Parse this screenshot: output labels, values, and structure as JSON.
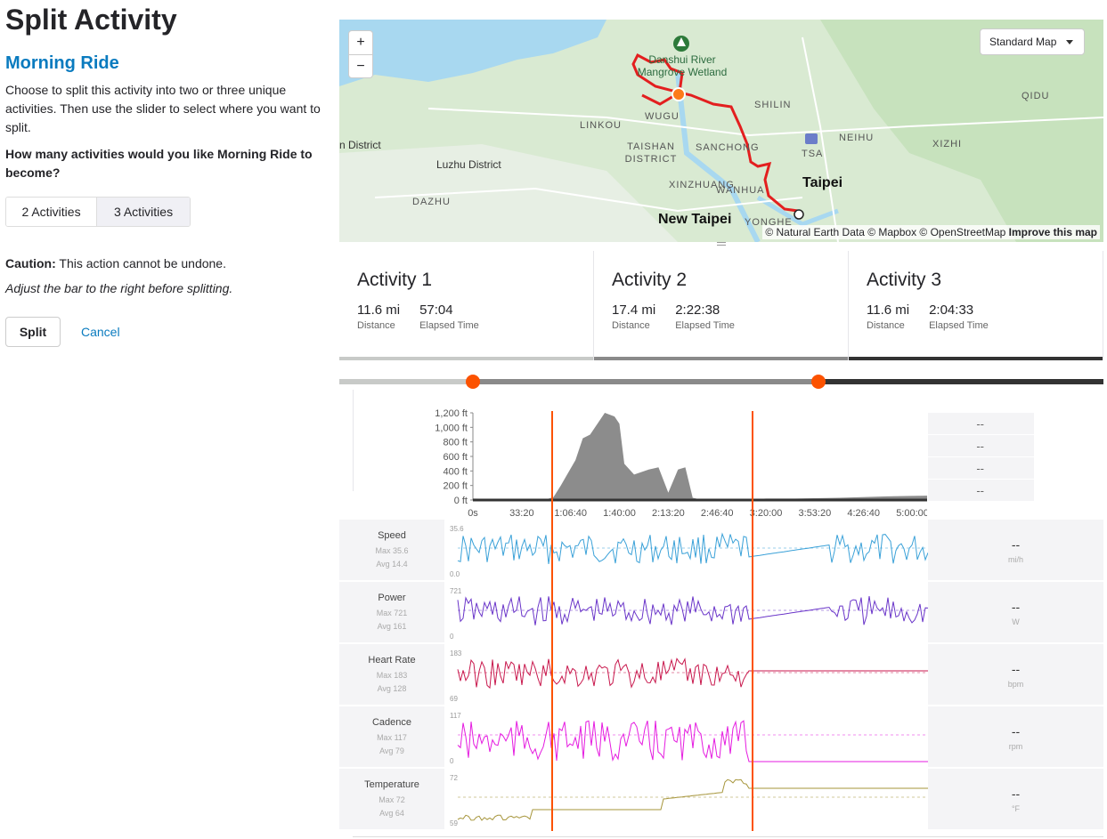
{
  "page_title": "Split Activity",
  "activity_name": "Morning Ride",
  "intro_text": "Choose to split this activity into two or three unique activities. Then use the slider to select where you want to split.",
  "question": "How many activities would you like Morning Ride to become?",
  "split_options": [
    "2 Activities",
    "3 Activities"
  ],
  "caution_label": "Caution:",
  "caution_text": " This action cannot be undone.",
  "hint_text": "Adjust the bar to the right before splitting.",
  "buttons": {
    "split": "Split",
    "cancel": "Cancel"
  },
  "map": {
    "zoom_in": "+",
    "zoom_out": "−",
    "style_select": "Standard Map",
    "attribution": "© Natural Earth Data © Mapbox © OpenStreetMap",
    "attribution_link": "Improve this map",
    "labels": {
      "wetland": "Danshui River Mangrove Wetland",
      "shilin": "SHILIN",
      "linkou": "LINKOU",
      "wugu": "WUGU",
      "neihu": "NEIHU",
      "qidu": "QIDU",
      "xizhi": "XIZHI",
      "taishan": "TAISHAN DISTRICT",
      "sanchong": "SANCHONG",
      "tsa": "TSA",
      "district_left": "n District",
      "luzhu": "Luzhu District",
      "taipei": "Taipei",
      "xinzhuang": "XINZHUANG",
      "wanhua": "WANHUA",
      "dazhu": "DAZHU",
      "new_taipei": "New Taipei",
      "yonghe": "YONGHE"
    }
  },
  "activities": [
    {
      "title": "Activity 1",
      "distance": "11.6 mi",
      "elapsed": "57:04",
      "distance_label": "Distance",
      "elapsed_label": "Elapsed Time",
      "color": "#c8cac8"
    },
    {
      "title": "Activity 2",
      "distance": "17.4 mi",
      "elapsed": "2:22:38",
      "distance_label": "Distance",
      "elapsed_label": "Elapsed Time",
      "color": "#8a8a8a"
    },
    {
      "title": "Activity 3",
      "distance": "11.6 mi",
      "elapsed": "2:04:33",
      "distance_label": "Distance",
      "elapsed_label": "Elapsed Time",
      "color": "#333333"
    }
  ],
  "split_points_fraction": [
    0.175,
    0.627
  ],
  "elevation_side_values": [
    "--",
    "--",
    "--",
    "--"
  ],
  "chart_data": {
    "type": "area",
    "title": "",
    "xlabel": "",
    "ylabel": "",
    "y_ticks": [
      "1,200 ft",
      "1,000 ft",
      "800 ft",
      "600 ft",
      "400 ft",
      "200 ft",
      "0 ft"
    ],
    "x_ticks": [
      "0s",
      "33:20",
      "1:06:40",
      "1:40:00",
      "2:13:20",
      "2:46:40",
      "3:20:00",
      "3:53:20",
      "4:26:40",
      "5:00:00"
    ],
    "ylim": [
      0,
      1200
    ],
    "x_seconds": [
      0,
      1800,
      3000,
      3300,
      3600,
      4200,
      4500,
      4800,
      5400,
      5800,
      6000,
      6200,
      6600,
      7200,
      7600,
      8000,
      8400,
      8700,
      9000,
      9300,
      9600,
      10200,
      10800,
      11400,
      12000,
      13200,
      15000,
      17000,
      18600
    ],
    "elevation_ft": [
      20,
      10,
      10,
      40,
      200,
      550,
      850,
      900,
      1200,
      1150,
      1050,
      500,
      350,
      420,
      450,
      100,
      420,
      450,
      30,
      10,
      10,
      10,
      10,
      10,
      20,
      20,
      30,
      50,
      60
    ],
    "series_color": "#8c8c8c"
  },
  "streams": [
    {
      "name": "Speed",
      "max": "Max 35.6",
      "avg": "Avg 14.4",
      "top": "35.6",
      "bottom": "0.0",
      "value": "--",
      "unit": "mi/h",
      "color": "#3aa1d8"
    },
    {
      "name": "Power",
      "max": "Max 721",
      "avg": "Avg 161",
      "top": "721",
      "bottom": "0",
      "value": "--",
      "unit": "W",
      "color": "#6a35c9"
    },
    {
      "name": "Heart Rate",
      "max": "Max 183",
      "avg": "Avg 128",
      "top": "183",
      "bottom": "69",
      "value": "--",
      "unit": "bpm",
      "color": "#c8174c"
    },
    {
      "name": "Cadence",
      "max": "Max 117",
      "avg": "Avg 79",
      "top": "117",
      "bottom": "0",
      "value": "--",
      "unit": "rpm",
      "color": "#e51be0"
    },
    {
      "name": "Temperature",
      "max": "Max 72",
      "avg": "Avg 64",
      "top": "72",
      "bottom": "59",
      "value": "--",
      "unit": "°F",
      "color": "#a6953a"
    }
  ]
}
